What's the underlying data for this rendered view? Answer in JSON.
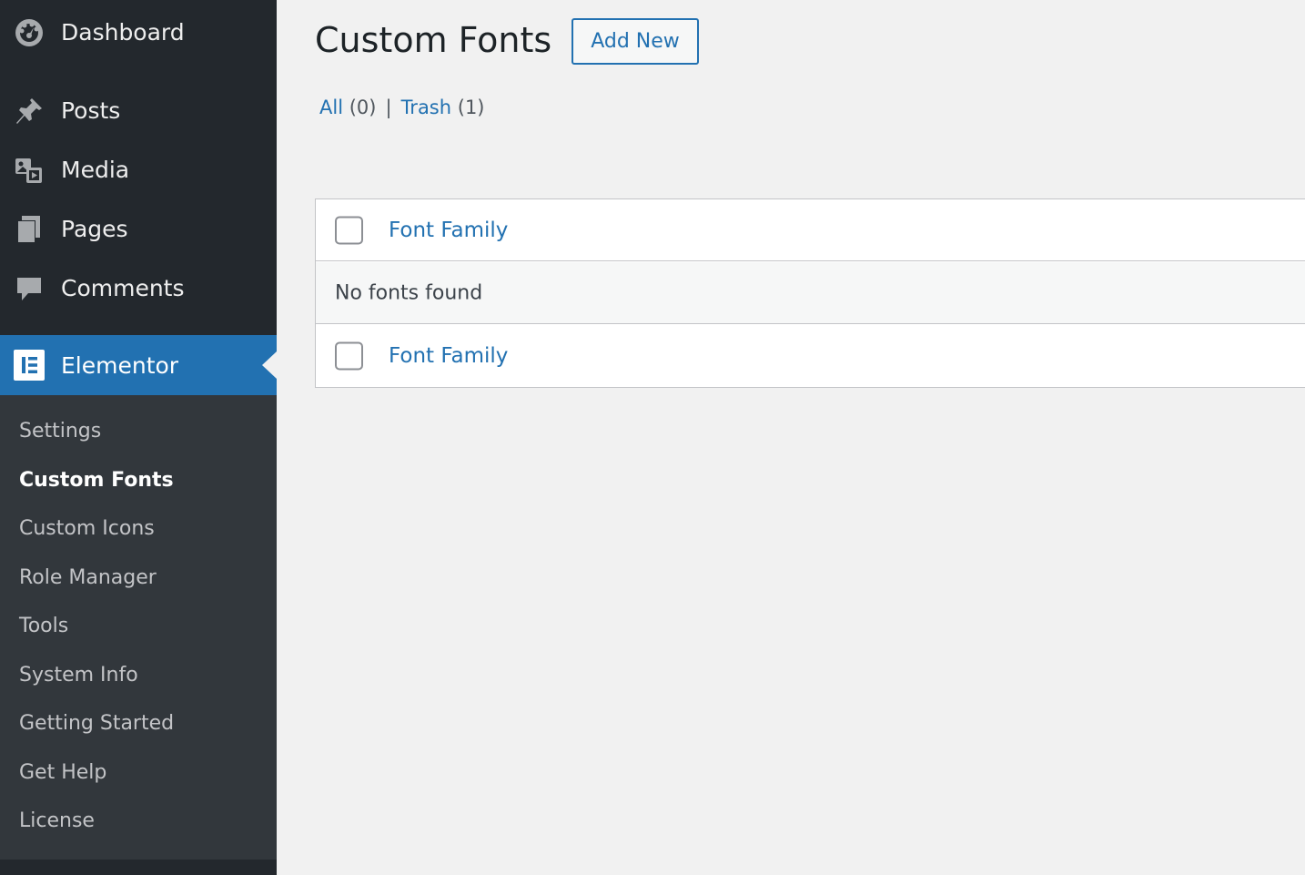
{
  "sidebar": {
    "items": [
      {
        "label": "Dashboard",
        "icon": "dashboard-icon"
      },
      {
        "label": "Posts",
        "icon": "pin-icon"
      },
      {
        "label": "Media",
        "icon": "media-icon"
      },
      {
        "label": "Pages",
        "icon": "pages-icon"
      },
      {
        "label": "Comments",
        "icon": "comment-icon"
      },
      {
        "label": "Elementor",
        "icon": "elementor-icon",
        "active": true
      }
    ],
    "submenu": [
      {
        "label": "Settings"
      },
      {
        "label": "Custom Fonts",
        "current": true
      },
      {
        "label": "Custom Icons"
      },
      {
        "label": "Role Manager"
      },
      {
        "label": "Tools"
      },
      {
        "label": "System Info"
      },
      {
        "label": "Getting Started"
      },
      {
        "label": "Get Help"
      },
      {
        "label": "License"
      }
    ]
  },
  "main": {
    "title": "Custom Fonts",
    "add_new_label": "Add New",
    "filters": {
      "all_label": "All",
      "all_count": "(0)",
      "separator": "|",
      "trash_label": "Trash",
      "trash_count": "(1)"
    },
    "table": {
      "column_header": "Font Family",
      "empty_message": "No fonts found",
      "column_footer": "Font Family"
    }
  },
  "colors": {
    "sidebar_bg": "#23282d",
    "submenu_bg": "#32373c",
    "accent": "#2271b1",
    "page_bg": "#f1f1f1"
  }
}
